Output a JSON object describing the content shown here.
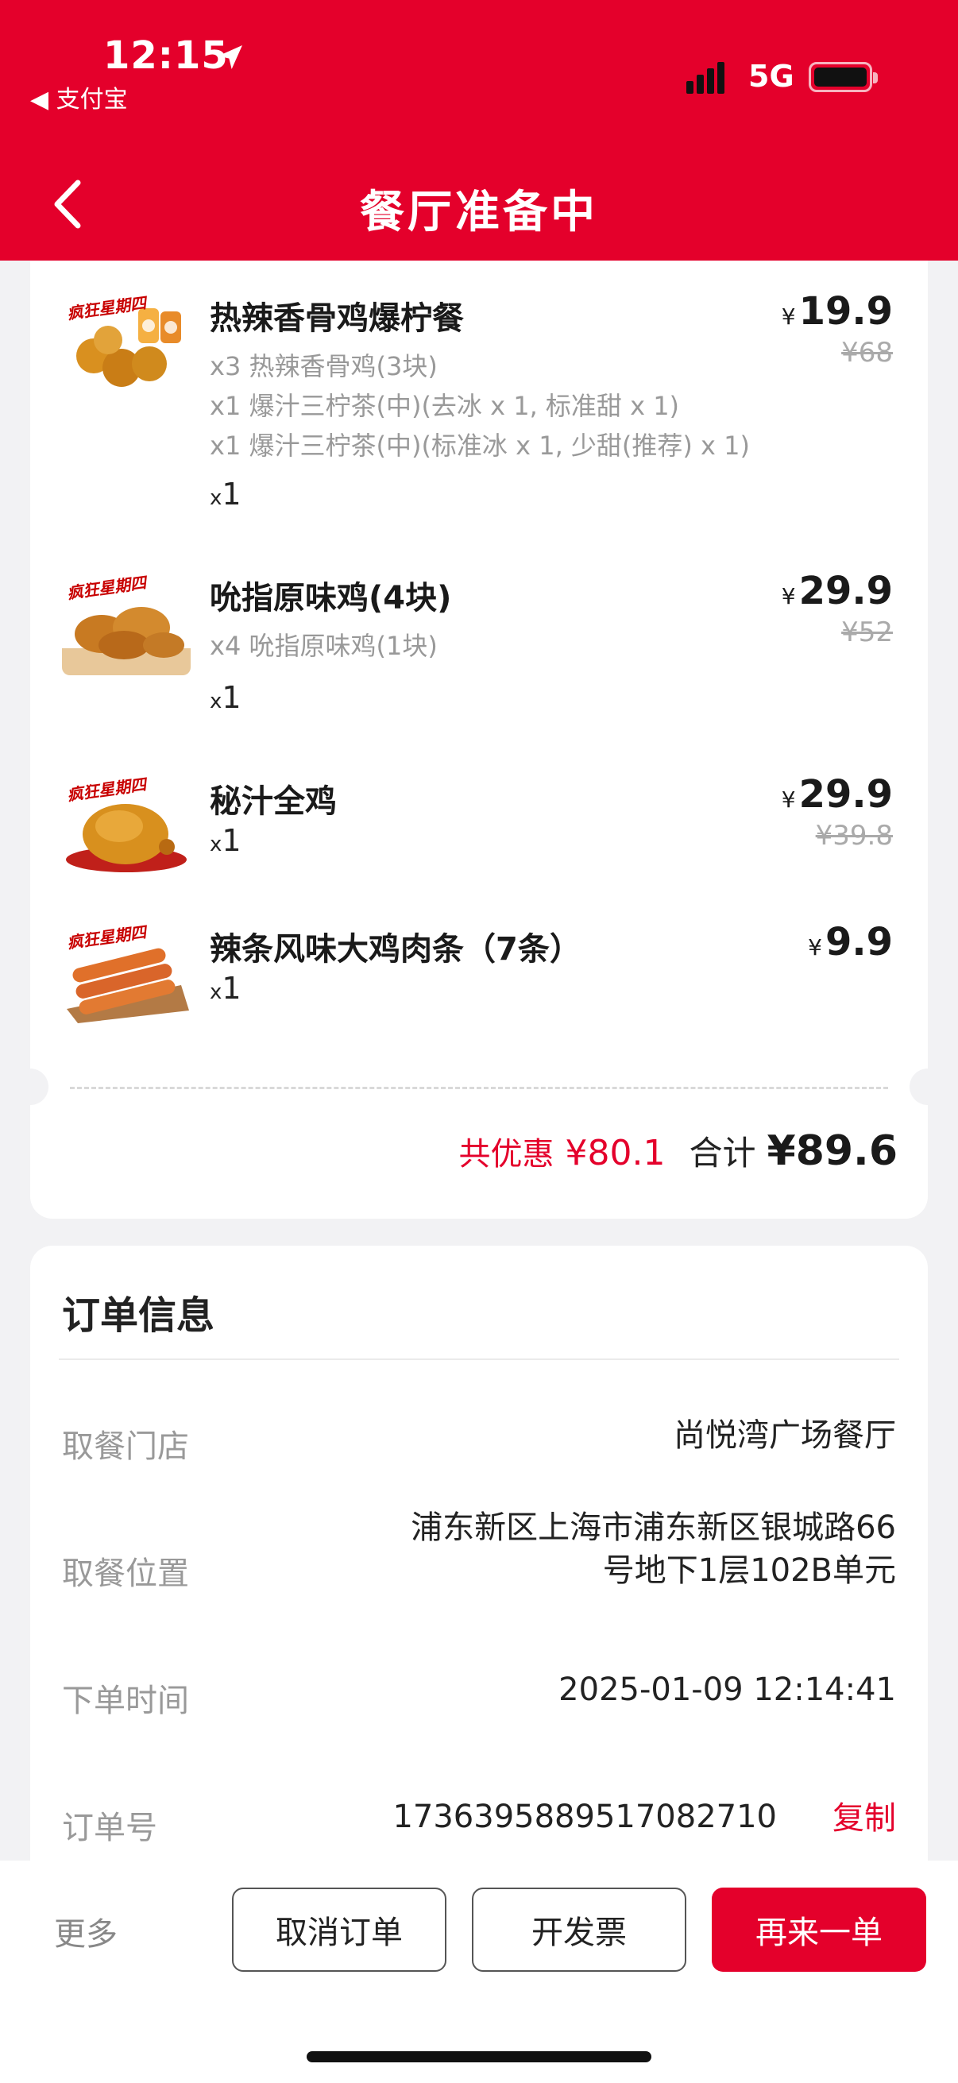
{
  "status_bar": {
    "time": "12:15",
    "back_app": "◀ 支付宝",
    "network": "5G"
  },
  "header": {
    "title": "餐厅准备中"
  },
  "items": [
    {
      "name": "热辣香骨鸡爆柠餐",
      "desc": [
        "x3 热辣香骨鸡(3块)",
        "x1 爆汁三柠茶(中)(去冰 x 1, 标准甜 x 1)",
        "x1 爆汁三柠茶(中)(标准冰 x 1, 少甜(推荐) x 1)"
      ],
      "qty": "1",
      "price": "19.9",
      "original_price": "¥68",
      "badge": "疯狂星期四"
    },
    {
      "name": "吮指原味鸡(4块)",
      "desc": [
        "x4 吮指原味鸡(1块)"
      ],
      "qty": "1",
      "price": "29.9",
      "original_price": "¥52",
      "badge": "疯狂星期四"
    },
    {
      "name": "秘汁全鸡",
      "desc": [],
      "qty": "1",
      "price": "29.9",
      "original_price": "¥39.8",
      "badge": "疯狂星期四"
    },
    {
      "name": "辣条风味大鸡肉条（7条）",
      "desc": [],
      "qty": "1",
      "price": "9.9",
      "original_price": "",
      "badge": "疯狂星期四"
    }
  ],
  "summary": {
    "discount_label": "共优惠",
    "discount_value": "¥80.1",
    "total_label": "合计",
    "total_value": "¥89.6"
  },
  "order_info": {
    "title": "订单信息",
    "store_label": "取餐门店",
    "store_value": "尚悦湾广场餐厅",
    "location_label": "取餐位置",
    "location_line1": "浦东新区上海市浦东新区银城路66",
    "location_line2": "号地下1层102B单元",
    "time_label": "下单时间",
    "time_value": "2025-01-09 12:14:41",
    "order_no_label": "订单号",
    "order_no_value": "1736395889517082710",
    "copy_label": "复制"
  },
  "bottom_bar": {
    "more": "更多",
    "cancel": "取消订单",
    "invoice": "开发票",
    "reorder": "再来一单"
  },
  "currency_symbol": "¥",
  "qty_prefix": "x",
  "colors": {
    "brand_red": "#e4002b",
    "background": "#f2f2f4"
  }
}
